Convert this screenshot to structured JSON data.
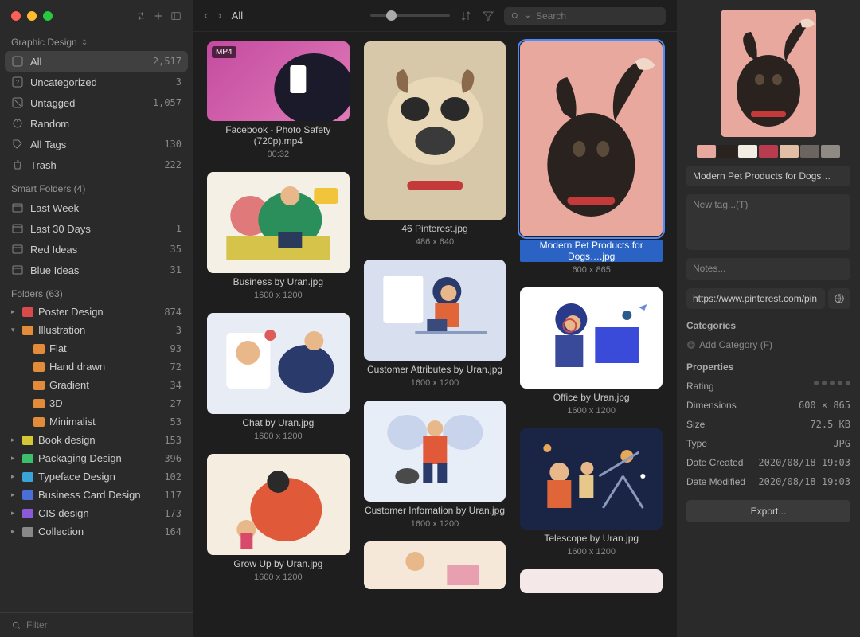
{
  "library": "Graphic Design",
  "filter_placeholder": "Filter",
  "search_placeholder": "Search",
  "breadcrumb": "All",
  "systems": [
    {
      "label": "All",
      "count": "2,517",
      "icon": "all"
    },
    {
      "label": "Uncategorized",
      "count": "3",
      "icon": "uncat"
    },
    {
      "label": "Untagged",
      "count": "1,057",
      "icon": "untag"
    },
    {
      "label": "Random",
      "count": "",
      "icon": "random"
    },
    {
      "label": "All Tags",
      "count": "130",
      "icon": "tags"
    },
    {
      "label": "Trash",
      "count": "222",
      "icon": "trash"
    }
  ],
  "smart_header": "Smart Folders (4)",
  "smart": [
    {
      "label": "Last Week",
      "count": ""
    },
    {
      "label": "Last 30 Days",
      "count": "1"
    },
    {
      "label": "Red Ideas",
      "count": "35"
    },
    {
      "label": "Blue Ideas",
      "count": "31"
    }
  ],
  "folders_header": "Folders (63)",
  "folders": [
    {
      "label": "Poster Design",
      "count": "874",
      "color": "#d94a4a",
      "open": false
    },
    {
      "label": "Illustration",
      "count": "3",
      "color": "#e28b3a",
      "open": true,
      "children": [
        {
          "label": "Flat",
          "count": "93"
        },
        {
          "label": "Hand drawn",
          "count": "72"
        },
        {
          "label": "Gradient",
          "count": "34"
        },
        {
          "label": "3D",
          "count": "27"
        },
        {
          "label": "Minimalist",
          "count": "53"
        }
      ]
    },
    {
      "label": "Book design",
      "count": "153",
      "color": "#d6c634",
      "open": false
    },
    {
      "label": "Packaging Design",
      "count": "396",
      "color": "#3bbf6a",
      "open": false
    },
    {
      "label": "Typeface Design",
      "count": "102",
      "color": "#3aa4d6",
      "open": false
    },
    {
      "label": "Business Card Design",
      "count": "117",
      "color": "#4a6fd9",
      "open": false
    },
    {
      "label": "CIS design",
      "count": "173",
      "color": "#8a5ad9",
      "open": false
    },
    {
      "label": "Collection",
      "count": "164",
      "color": "#888888",
      "open": false
    }
  ],
  "cards": {
    "c0": {
      "title": "Facebook - Photo Safety (720p).mp4",
      "meta": "00:32",
      "badge": "MP4"
    },
    "c1": {
      "title": "Business by Uran.jpg",
      "meta": "1600 x 1200"
    },
    "c2": {
      "title": "Chat by Uran.jpg",
      "meta": "1600 x 1200"
    },
    "c3": {
      "title": "Grow Up by Uran.jpg",
      "meta": "1600 x 1200"
    },
    "c4": {
      "title": "46 Pinterest.jpg",
      "meta": "486 x 640"
    },
    "c5": {
      "title": "Customer Attributes by Uran.jpg",
      "meta": "1600 x 1200"
    },
    "c6": {
      "title": "Customer Infomation by Uran.jpg",
      "meta": "1600 x 1200"
    },
    "c7": {
      "title": "Modern Pet Products for Dogs….jpg",
      "meta": "600 x 865"
    },
    "c8": {
      "title": "Office by Uran.jpg",
      "meta": "1600 x 1200"
    },
    "c9": {
      "title": "Telescope by Uran.jpg",
      "meta": "1600 x 1200"
    }
  },
  "inspector": {
    "name": "Modern Pet Products for Dogs…",
    "tag_placeholder": "New tag...(T)",
    "notes_placeholder": "Notes...",
    "url": "https://www.pinterest.com/pin",
    "categories_label": "Categories",
    "add_category": "Add Category (F)",
    "properties_label": "Properties",
    "props": {
      "rating_label": "Rating",
      "dim_label": "Dimensions",
      "dim": "600 × 865",
      "size_label": "Size",
      "size": "72.5 KB",
      "type_label": "Type",
      "type": "JPG",
      "created_label": "Date Created",
      "created": "2020/08/18 19:03",
      "modified_label": "Date Modified",
      "modified": "2020/08/18 19:03"
    },
    "export": "Export...",
    "swatches": [
      "#e8a89e",
      "#2a221f",
      "#f2ede3",
      "#b83b4e",
      "#e2bfa4",
      "#6b6460",
      "#8f8a84"
    ]
  }
}
